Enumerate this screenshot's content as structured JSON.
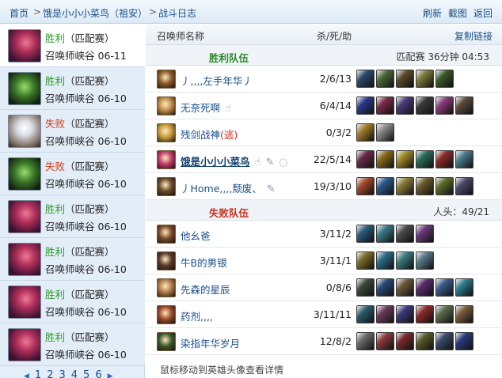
{
  "nav": {
    "home": "首页",
    "sep": ">",
    "player": "饿是小小小菜鸟（祖安）",
    "page": "战斗日志",
    "refresh": "刷新",
    "screenshot": "截图",
    "back": "返回"
  },
  "matches": [
    {
      "result": "胜利",
      "mode": "（匹配赛）",
      "map": "召唤师峡谷",
      "date": "06-11",
      "win": true,
      "avatar": "c1"
    },
    {
      "result": "胜利",
      "mode": "（匹配赛）",
      "map": "召唤师峡谷",
      "date": "06-10",
      "win": true,
      "avatar": "c2"
    },
    {
      "result": "失败",
      "mode": "（匹配赛）",
      "map": "召唤师峡谷",
      "date": "06-10",
      "win": false,
      "avatar": "c3"
    },
    {
      "result": "失败",
      "mode": "（匹配赛）",
      "map": "召唤师峡谷",
      "date": "06-10",
      "win": false,
      "avatar": "c2"
    },
    {
      "result": "胜利",
      "mode": "（匹配赛）",
      "map": "召唤师峡谷",
      "date": "06-10",
      "win": true,
      "avatar": "c1"
    },
    {
      "result": "胜利",
      "mode": "（匹配赛）",
      "map": "召唤师峡谷",
      "date": "06-10",
      "win": true,
      "avatar": "c1"
    },
    {
      "result": "胜利",
      "mode": "（匹配赛）",
      "map": "召唤师峡谷",
      "date": "06-10",
      "win": true,
      "avatar": "c1"
    },
    {
      "result": "胜利",
      "mode": "（匹配赛）",
      "map": "召唤师峡谷",
      "date": "06-10",
      "win": true,
      "avatar": "c1"
    }
  ],
  "pager": {
    "prev": "◀",
    "pages": [
      "1",
      "2",
      "3",
      "4",
      "5",
      "6"
    ],
    "next": "▶"
  },
  "table": {
    "col_name": "召唤师名称",
    "col_kda": "杀/死/助",
    "copy_link": "复制链接"
  },
  "win_team": {
    "label": "胜利队伍",
    "info": "匹配赛 36分钟 04:53",
    "players": [
      {
        "name": "丿,,,,左手年华丿",
        "kda": "2/6/13",
        "champ": "#8a5a2a",
        "me": false,
        "flee": "",
        "gestures": [],
        "items": [
          "#2a4a6a",
          "#4a6a3a",
          "#5a4a2a",
          "#7a7a3a",
          "#3a5a2a"
        ]
      },
      {
        "name": "无奈死啊",
        "kda": "6/4/14",
        "champ": "#c08a4a",
        "me": false,
        "flee": "",
        "gestures": [
          "hand-icon"
        ],
        "items": [
          "#2a3a8a",
          "#7a2a4a",
          "#4a3a7a",
          "#3a3a3a",
          "#8a3a7a",
          "#5a4a3a"
        ]
      },
      {
        "name": "残剑战神",
        "kda": "0/3/2",
        "champ": "#c89a3a",
        "me": false,
        "flee": "(逃)",
        "gestures": [],
        "items": [
          "#a07a2a",
          "#8a8a8a"
        ]
      },
      {
        "name": "饿是小小小菜鸟",
        "kda": "22/5/14",
        "champ": "#c03a6a",
        "me": true,
        "flee": "",
        "gestures": [
          "hand-icon",
          "feather-icon",
          "speech-icon"
        ],
        "items": [
          "#6a2a4a",
          "#8a6a1a",
          "#a08a2a",
          "#2a6a5a",
          "#8a2a2a",
          "#4a7a8a"
        ]
      },
      {
        "name": "丿Home,,,,颓废、",
        "kda": "19/3/10",
        "champ": "#6a4a2a",
        "me": false,
        "flee": "",
        "gestures": [
          "feather-icon"
        ],
        "items": [
          "#a04a2a",
          "#2a5a8a",
          "#8a7a3a",
          "#6a5a2a",
          "#5a6a2a",
          "#4a4a6a"
        ]
      }
    ]
  },
  "lose_team": {
    "label": "失败队伍",
    "info": "人头：49/21",
    "players": [
      {
        "name": "他幺爸",
        "kda": "3/11/2",
        "champ": "#7a4a2a",
        "me": false,
        "flee": "",
        "gestures": [],
        "items": [
          "#2a5a7a",
          "#3a7a8a",
          "#4a4a4a",
          "#6a3a7a"
        ]
      },
      {
        "name": "牛B的男银",
        "kda": "3/11/1",
        "champ": "#5a3a2a",
        "me": false,
        "flee": "",
        "gestures": [],
        "items": [
          "#7a6a2a",
          "#2a6a8a",
          "#3a7a7a",
          "#5a7a8a"
        ]
      },
      {
        "name": "先森的星辰",
        "kda": "0/8/6",
        "champ": "#b07a4a",
        "me": false,
        "flee": "",
        "gestures": [],
        "items": [
          "#3a4a3a",
          "#2a4a7a",
          "#6a5a3a",
          "#5a2a6a",
          "#3a5a8a",
          "#2a7a8a"
        ]
      },
      {
        "name": "药剂,,,,",
        "kda": "3/11/11",
        "champ": "#9a4a2a",
        "me": false,
        "flee": "",
        "gestures": [],
        "items": [
          "#2a5a6a",
          "#6a3a5a",
          "#3a3a7a",
          "#8a2a2a",
          "#5a6a4a",
          "#7a5a3a"
        ]
      },
      {
        "name": "染指年华岁月",
        "kda": "12/8/2",
        "champ": "#3a5a2a",
        "me": false,
        "flee": "",
        "gestures": [],
        "items": [
          "#6a6a6a",
          "#8a3a3a",
          "#7a2a2a",
          "#5a5a2a",
          "#3a4a6a",
          "#2a3a7a"
        ]
      }
    ]
  },
  "hint": "鼠标移动到英雄头像查看详情",
  "gesture_glyphs": {
    "hand-icon": "☝",
    "feather-icon": "✎",
    "speech-icon": "◌"
  }
}
